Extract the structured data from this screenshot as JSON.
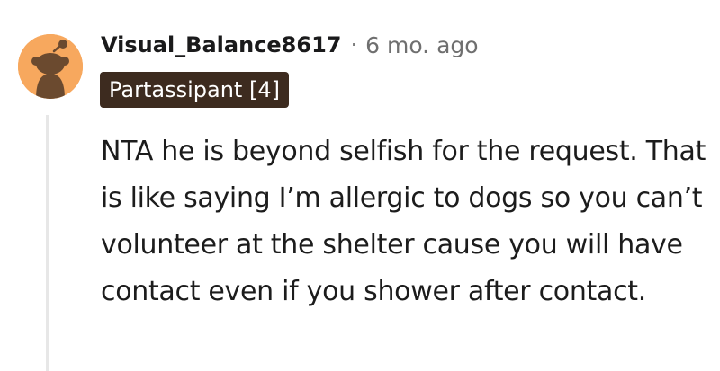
{
  "comment": {
    "author": "Visual_Balance8617",
    "separator": "·",
    "age": "6 mo. ago",
    "flair": "Partassipant [4]",
    "body": "NTA he is beyond selfish for the request. That is like saying I’m allergic to dogs so you can’t volunteer at the shelter cause you will have contact even if you shower after contact."
  },
  "avatar": {
    "icon": "snoo-avatar-icon",
    "background_color": "#f7a85e"
  },
  "colors": {
    "flair_background": "#3d2b1f",
    "flair_text": "#ffffff",
    "thread_line": "#e7e7e7"
  }
}
